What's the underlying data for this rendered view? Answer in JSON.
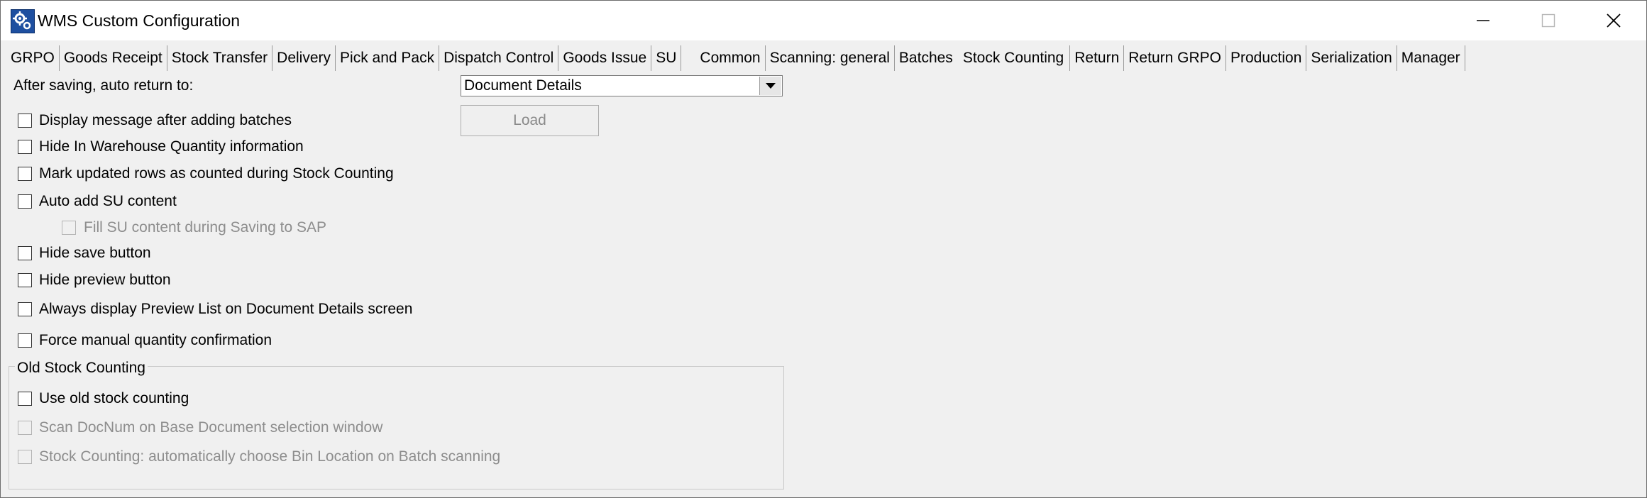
{
  "window": {
    "title": "WMS Custom Configuration",
    "icon": "gear-app-icon",
    "controls": [
      "minimize-icon",
      "maximize-icon",
      "close-icon"
    ]
  },
  "tabs": [
    {
      "label": "GRPO"
    },
    {
      "label": "Goods Receipt"
    },
    {
      "label": "Stock Transfer"
    },
    {
      "label": "Delivery"
    },
    {
      "label": "Pick and Pack"
    },
    {
      "label": "Dispatch Control"
    },
    {
      "label": "Goods Issue"
    },
    {
      "label": "SU"
    },
    {
      "label": "Common"
    },
    {
      "label": "Scanning: general"
    },
    {
      "label": "Batches"
    },
    {
      "label": "Stock Counting",
      "active": true
    },
    {
      "label": "Return"
    },
    {
      "label": "Return GRPO"
    },
    {
      "label": "Production"
    },
    {
      "label": "Serialization"
    },
    {
      "label": "Manager"
    }
  ],
  "settings": {
    "after_saving_label": "After saving, auto return to:",
    "after_saving_value": "Document Details",
    "load_button": "Load",
    "checkboxes": [
      {
        "label": "Display message after adding batches",
        "checked": false,
        "enabled": true
      },
      {
        "label": "Hide In Warehouse Quantity information",
        "checked": false,
        "enabled": true
      },
      {
        "label": "Mark updated rows as counted during Stock Counting",
        "checked": false,
        "enabled": true
      },
      {
        "label": "Auto add SU content",
        "checked": false,
        "enabled": true
      },
      {
        "label": "Fill SU content during Saving to SAP",
        "checked": false,
        "enabled": false
      },
      {
        "label": "Hide save button",
        "checked": false,
        "enabled": true
      },
      {
        "label": "Hide preview button",
        "checked": false,
        "enabled": true
      },
      {
        "label": "Always display Preview List on Document Details screen",
        "checked": false,
        "enabled": true
      },
      {
        "label": "Force manual quantity confirmation",
        "checked": false,
        "enabled": true
      }
    ]
  },
  "old_stock_counting": {
    "title": "Old Stock Counting",
    "checkboxes": [
      {
        "label": "Use old stock counting",
        "checked": false,
        "enabled": true
      },
      {
        "label": "Scan DocNum on Base Document selection window",
        "checked": false,
        "enabled": false
      },
      {
        "label": "Stock Counting: automatically choose Bin Location on Batch scanning",
        "checked": false,
        "enabled": false
      }
    ]
  }
}
